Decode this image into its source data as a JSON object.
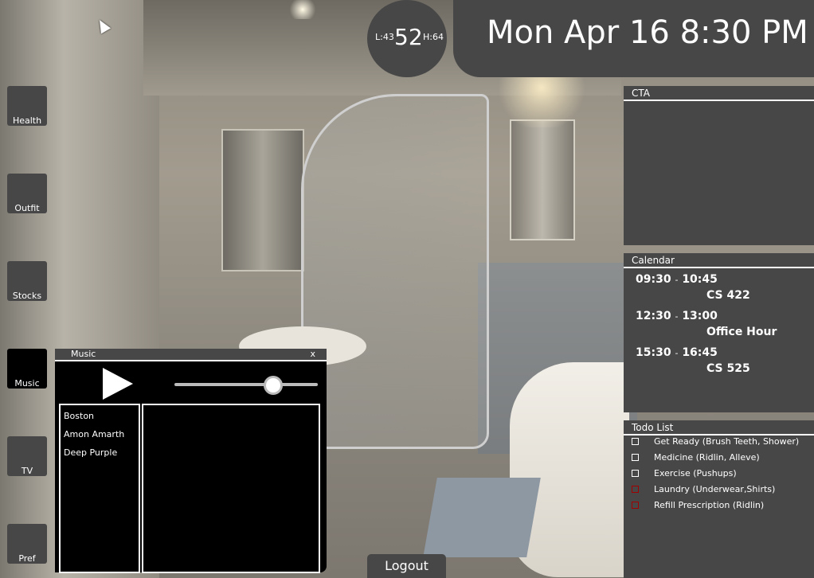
{
  "weather": {
    "low": "L:43",
    "current": "52",
    "high": "H:64"
  },
  "clock": {
    "datetime": "Mon Apr 16 8:30 PM"
  },
  "sidebar": {
    "items": [
      {
        "label": "Health"
      },
      {
        "label": "Outfit"
      },
      {
        "label": "Stocks"
      },
      {
        "label": "Music"
      },
      {
        "label": "TV"
      },
      {
        "label": "Pref"
      }
    ]
  },
  "cta": {
    "title": "CTA"
  },
  "calendar": {
    "title": "Calendar",
    "entries": [
      {
        "start": "09:30",
        "sep": "-",
        "end": "10:45",
        "event": "CS 422"
      },
      {
        "start": "12:30",
        "sep": "-",
        "end": "13:00",
        "event": "Office Hour"
      },
      {
        "start": "15:30",
        "sep": "-",
        "end": "16:45",
        "event": "CS 525"
      }
    ]
  },
  "todo": {
    "title": "Todo List",
    "items": [
      {
        "label": "Get Ready (Brush Teeth, Shower)",
        "urgent": false
      },
      {
        "label": "Medicine (Ridlin, Alleve)",
        "urgent": false
      },
      {
        "label": "Exercise (Pushups)",
        "urgent": false
      },
      {
        "label": "Laundry (Underwear,Shirts)",
        "urgent": true
      },
      {
        "label": "Refill Prescription (Ridlin)",
        "urgent": true
      }
    ]
  },
  "music": {
    "title": "Music",
    "close": "x",
    "volume": 0.68,
    "playlist": [
      "Boston",
      "Amon Amarth",
      "Deep Purple"
    ]
  },
  "logout": {
    "label": "Logout"
  },
  "colors": {
    "panel": "#474747",
    "urgent": "#a10000"
  }
}
